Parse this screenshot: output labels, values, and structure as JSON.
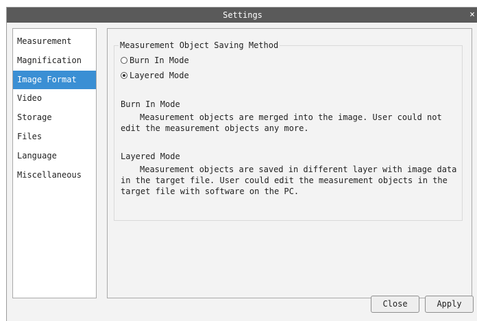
{
  "window": {
    "title": "Settings",
    "close_glyph": "×"
  },
  "sidebar": {
    "items": [
      {
        "label": "Measurement",
        "selected": false
      },
      {
        "label": "Magnification",
        "selected": false
      },
      {
        "label": "Image Format",
        "selected": true
      },
      {
        "label": "Video",
        "selected": false
      },
      {
        "label": "Storage",
        "selected": false
      },
      {
        "label": "Files",
        "selected": false
      },
      {
        "label": "Language",
        "selected": false
      },
      {
        "label": "Miscellaneous",
        "selected": false
      }
    ]
  },
  "image_format": {
    "group_title": "Measurement Object Saving Method",
    "options": [
      {
        "label": "Burn In Mode",
        "checked": false
      },
      {
        "label": "Layered Mode",
        "checked": true
      }
    ],
    "burn_in": {
      "title": "Burn In Mode",
      "text": "Measurement objects are merged into the image. User could not edit the measurement objects any more."
    },
    "layered": {
      "title": "Layered Mode",
      "text": "Measurement objects are saved in different layer with image data in the target file. User could edit the measurement objects in the target file with software on the PC."
    }
  },
  "buttons": {
    "close_label": "Close",
    "apply_label": "Apply"
  },
  "colors": {
    "title_bar": "#5a5a5a",
    "selected_item": "#3a8fd4",
    "background": "#f3f3f3"
  }
}
